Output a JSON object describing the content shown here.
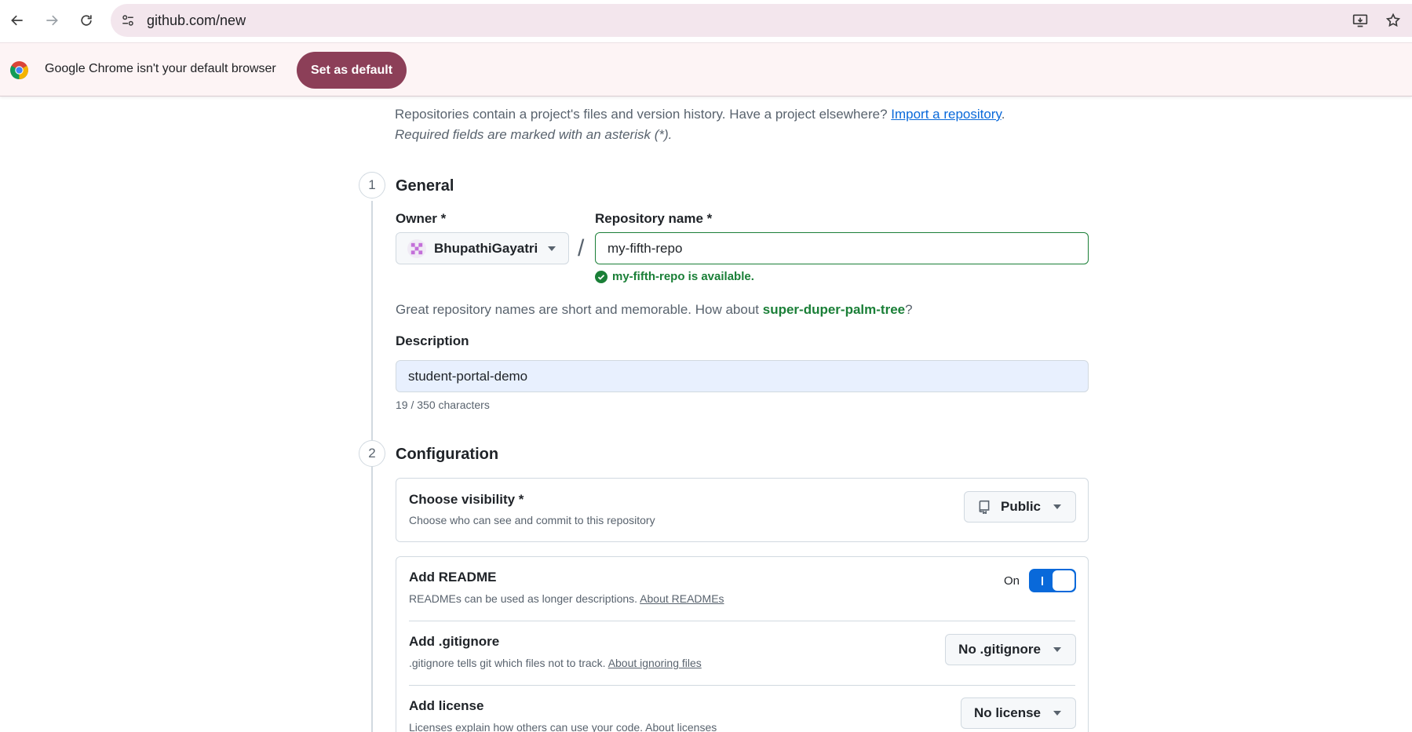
{
  "browser": {
    "url": "github.com/new",
    "infobar_text": "Google Chrome isn't your default browser",
    "set_default_label": "Set as default"
  },
  "page": {
    "intro_text": "Repositories contain a project's files and version history. Have a project elsewhere? ",
    "import_link": "Import a repository",
    "intro_end": ".",
    "required_note": "Required fields are marked with an asterisk (*)."
  },
  "general": {
    "step": "1",
    "title": "General",
    "owner_label": "Owner *",
    "owner_value": "BhupathiGayatri",
    "slash": "/",
    "repo_label": "Repository name *",
    "repo_value": "my-fifth-repo",
    "availability": "my-fifth-repo is available.",
    "suggest_prefix": "Great repository names are short and memorable. How about ",
    "suggest_name": "super-duper-palm-tree",
    "suggest_suffix": "?",
    "description_label": "Description",
    "description_value": "student-portal-demo",
    "char_count": "19 / 350 characters"
  },
  "configuration": {
    "step": "2",
    "title": "Configuration",
    "visibility_title": "Choose visibility *",
    "visibility_desc": "Choose who can see and commit to this repository",
    "visibility_value": "Public",
    "readme_title": "Add README",
    "readme_desc": "READMEs can be used as longer descriptions. ",
    "readme_link": "About READMEs",
    "readme_toggle_label": "On",
    "gitignore_title": "Add .gitignore",
    "gitignore_desc": ".gitignore tells git which files not to track. ",
    "gitignore_link": "About ignoring files",
    "gitignore_value": "No .gitignore",
    "license_title": "Add license",
    "license_desc": "Licenses explain how others can use your code. About licenses",
    "license_value": "No license"
  },
  "colors": {
    "accent_green": "#1a7f37",
    "link_blue": "#0969da",
    "infobar_button": "#8c3f58"
  }
}
